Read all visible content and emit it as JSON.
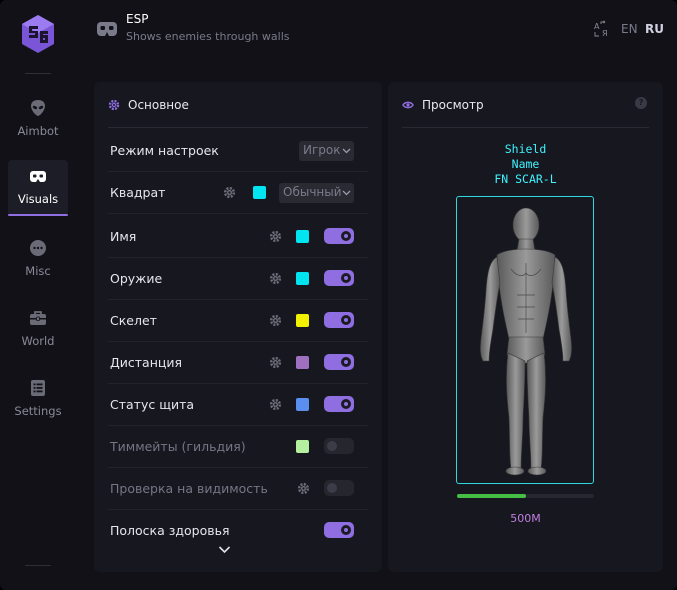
{
  "sidebar": {
    "items": [
      {
        "label": "Aimbot",
        "icon": "alien-icon",
        "active": false
      },
      {
        "label": "Visuals",
        "icon": "vr-goggles-icon",
        "active": true
      },
      {
        "label": "Misc",
        "icon": "chat-bubble-icon",
        "active": false
      },
      {
        "label": "World",
        "icon": "toolbox-icon",
        "active": false
      },
      {
        "label": "Settings",
        "icon": "list-icon",
        "active": false
      }
    ]
  },
  "header": {
    "icon": "vr-goggles-icon",
    "title": "ESP",
    "subtitle": "Shows enemies through walls",
    "languages": [
      "EN",
      "RU"
    ],
    "selected_language": "RU"
  },
  "main_panel": {
    "title": "Основное",
    "rows": [
      {
        "label": "Режим настроек",
        "select": "Игрок"
      },
      {
        "label": "Квадрат",
        "gear": true,
        "color": "#00e5f0",
        "select": "Обычный"
      },
      {
        "label": "Имя",
        "gear": true,
        "color": "#00e5f0",
        "toggle": true
      },
      {
        "label": "Оружие",
        "gear": true,
        "color": "#00e5f0",
        "toggle": true
      },
      {
        "label": "Скелет",
        "gear": true,
        "color": "#f2f200",
        "toggle": true
      },
      {
        "label": "Дистанция",
        "gear": true,
        "color": "#a070c0",
        "toggle": true
      },
      {
        "label": "Статус щита",
        "gear": true,
        "color": "#5a8ff0",
        "toggle": true
      },
      {
        "label": "Тиммейты (гильдия)",
        "gear": false,
        "color": "#b4f0a0",
        "toggle": false,
        "dim": true
      },
      {
        "label": "Проверка на видимость",
        "gear": true,
        "toggle": false,
        "dim": true
      },
      {
        "label": "Полоска здоровья",
        "gear": false,
        "toggle": true
      }
    ]
  },
  "preview_panel": {
    "title": "Просмотр",
    "esp_lines": [
      "Shield",
      "Name",
      "FN SCAR-L"
    ],
    "health_fraction": 0.5,
    "distance": "500M",
    "box_color": "#2fd8e0",
    "label_color": "#3ff3ff"
  },
  "accent": "#8e6ee0"
}
